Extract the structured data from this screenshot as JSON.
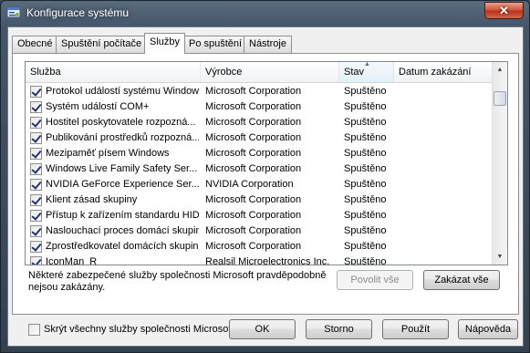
{
  "window": {
    "title": "Konfigurace systému",
    "close_label": "✕"
  },
  "tabs": [
    {
      "label": "Obecné",
      "active": false
    },
    {
      "label": "Spuštění počítače",
      "active": false
    },
    {
      "label": "Služby",
      "active": true
    },
    {
      "label": "Po spuštění",
      "active": false
    },
    {
      "label": "Nástroje",
      "active": false
    }
  ],
  "services": {
    "columns": [
      "Služba",
      "Výrobce",
      "Stav",
      "Datum zakázání"
    ],
    "sorted_column": "Stav",
    "rows": [
      {
        "checked": true,
        "name": "Protokol událostí systému Windows",
        "vendor": "Microsoft Corporation",
        "status": "Spuštěno",
        "disabled_date": ""
      },
      {
        "checked": true,
        "name": "Systém událostí COM+",
        "vendor": "Microsoft Corporation",
        "status": "Spuštěno",
        "disabled_date": ""
      },
      {
        "checked": true,
        "name": "Hostitel poskytovatele rozpozná...",
        "vendor": "Microsoft Corporation",
        "status": "Spuštěno",
        "disabled_date": ""
      },
      {
        "checked": true,
        "name": "Publikování prostředků rozpozná...",
        "vendor": "Microsoft Corporation",
        "status": "Spuštěno",
        "disabled_date": ""
      },
      {
        "checked": true,
        "name": "Mezipaměť písem Windows",
        "vendor": "Microsoft Corporation",
        "status": "Spuštěno",
        "disabled_date": ""
      },
      {
        "checked": true,
        "name": "Windows Live Family Safety Ser...",
        "vendor": "Microsoft Corporation",
        "status": "Spuštěno",
        "disabled_date": ""
      },
      {
        "checked": true,
        "name": "NVIDIA GeForce Experience Ser...",
        "vendor": "NVIDIA Corporation",
        "status": "Spuštěno",
        "disabled_date": ""
      },
      {
        "checked": true,
        "name": "Klient zásad skupiny",
        "vendor": "Microsoft Corporation",
        "status": "Spuštěno",
        "disabled_date": ""
      },
      {
        "checked": true,
        "name": "Přístup k zařízením standardu HID",
        "vendor": "Microsoft Corporation",
        "status": "Spuštěno",
        "disabled_date": ""
      },
      {
        "checked": true,
        "name": "Naslouchací proces domácí skupiny",
        "vendor": "Microsoft Corporation",
        "status": "Spuštěno",
        "disabled_date": ""
      },
      {
        "checked": true,
        "name": "Zprostředkovatel domácích skupin",
        "vendor": "Microsoft Corporation",
        "status": "Spuštěno",
        "disabled_date": ""
      },
      {
        "checked": true,
        "name": "IconMan_R",
        "vendor": "Realsil Microelectronics Inc.",
        "status": "Spuštěno",
        "disabled_date": ""
      }
    ]
  },
  "note": "Některé zabezpečené služby společnosti Microsoft pravděpodobně nejsou zakázány.",
  "buttons": {
    "enable_all": "Povolit vše",
    "disable_all": "Zakázat vše",
    "ok": "OK",
    "cancel": "Storno",
    "apply": "Použít",
    "help": "Nápověda"
  },
  "hide_ms": {
    "label": "Skrýt všechny služby společnosti Microsoft",
    "checked": false
  },
  "icons": {
    "window_icon": "system-config-icon",
    "sort_indicator": "sort-ascending-icon"
  }
}
